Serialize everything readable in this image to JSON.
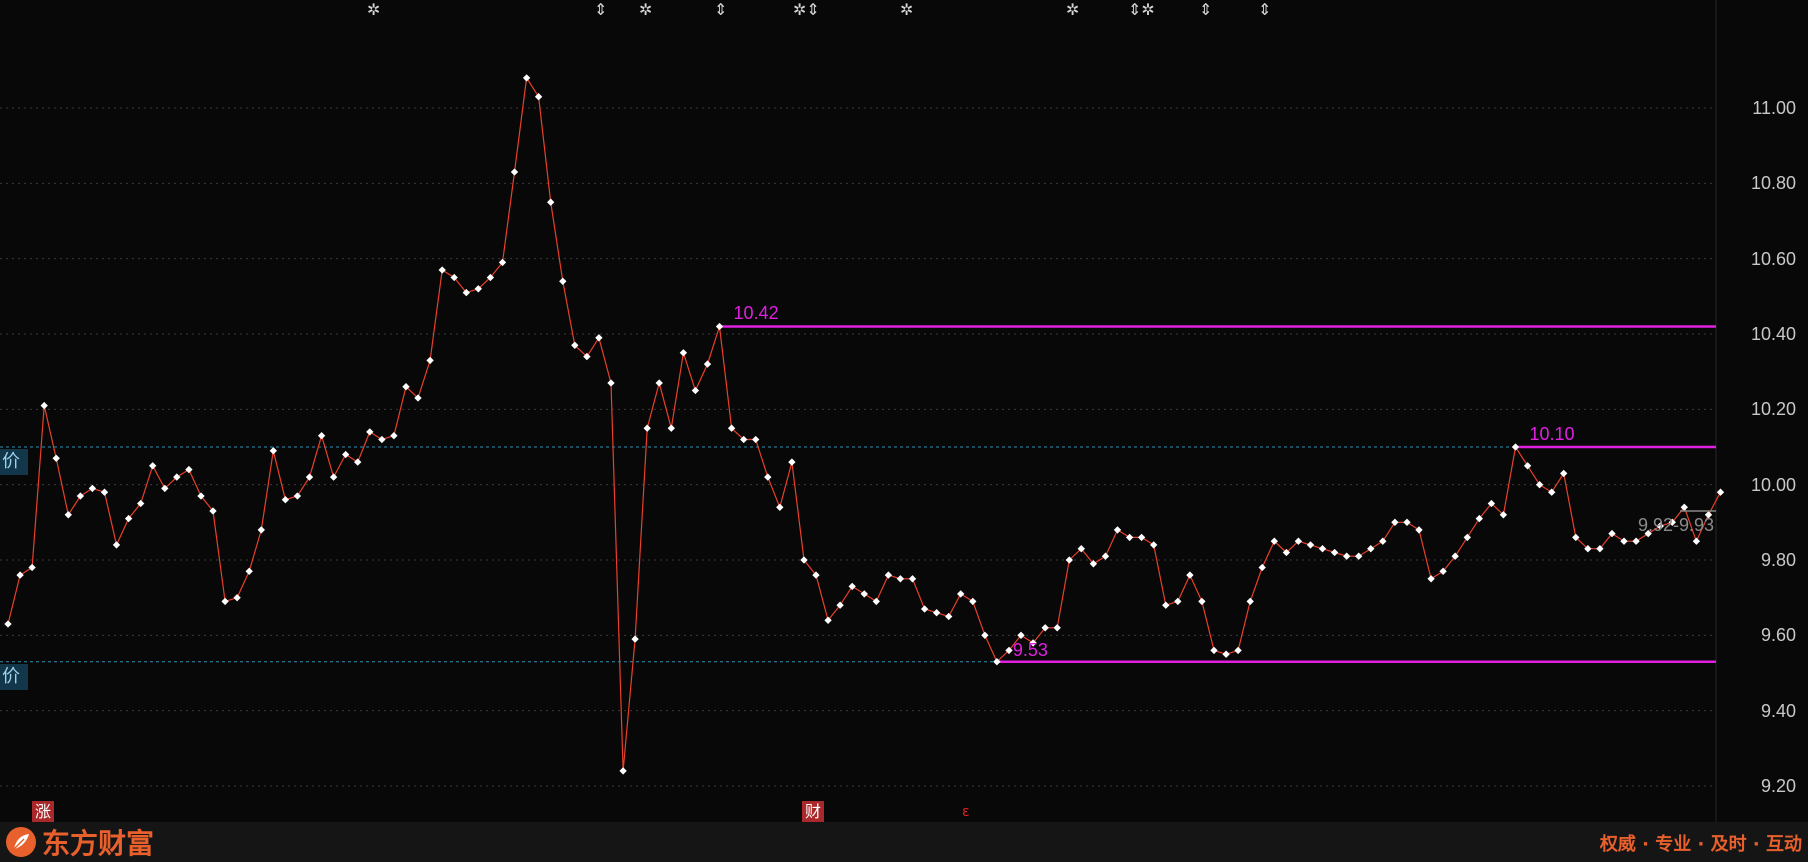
{
  "chart_data": {
    "type": "line",
    "y_ticks": [
      "11.00",
      "10.80",
      "10.60",
      "10.40",
      "10.20",
      "10.00",
      "9.80",
      "9.60",
      "9.40",
      "9.20"
    ],
    "ylim": [
      9.17,
      11.27
    ],
    "grid": true,
    "values": [
      9.63,
      9.76,
      9.78,
      10.21,
      10.07,
      9.92,
      9.97,
      9.99,
      9.98,
      9.84,
      9.91,
      9.95,
      10.05,
      9.99,
      10.02,
      10.04,
      9.97,
      9.93,
      9.69,
      9.7,
      9.77,
      9.88,
      10.09,
      9.96,
      9.97,
      10.02,
      10.13,
      10.02,
      10.08,
      10.06,
      10.14,
      10.12,
      10.13,
      10.26,
      10.23,
      10.33,
      10.57,
      10.55,
      10.51,
      10.52,
      10.55,
      10.59,
      10.83,
      11.08,
      11.03,
      10.75,
      10.54,
      10.37,
      10.34,
      10.39,
      10.27,
      9.24,
      9.59,
      10.15,
      10.27,
      10.15,
      10.35,
      10.25,
      10.32,
      10.42,
      10.15,
      10.12,
      10.12,
      10.02,
      9.94,
      10.06,
      9.8,
      9.76,
      9.64,
      9.68,
      9.73,
      9.71,
      9.69,
      9.76,
      9.75,
      9.75,
      9.67,
      9.66,
      9.65,
      9.71,
      9.69,
      9.6,
      9.53,
      9.56,
      9.6,
      9.58,
      9.62,
      9.62,
      9.8,
      9.83,
      9.79,
      9.81,
      9.88,
      9.86,
      9.86,
      9.84,
      9.68,
      9.69,
      9.76,
      9.69,
      9.56,
      9.55,
      9.56,
      9.69,
      9.78,
      9.85,
      9.82,
      9.85,
      9.84,
      9.83,
      9.82,
      9.81,
      9.81,
      9.83,
      9.85,
      9.9,
      9.9,
      9.88,
      9.75,
      9.77,
      9.81,
      9.86,
      9.91,
      9.95,
      9.92,
      10.1,
      10.05,
      10.0,
      9.98,
      10.03,
      9.86,
      9.83,
      9.83,
      9.87,
      9.85,
      9.85,
      9.87,
      9.89,
      9.9,
      9.94,
      9.85,
      9.92,
      9.98
    ],
    "ref_lines": [
      10.1,
      9.53
    ],
    "highlight_lines": [
      {
        "label": "10.42",
        "value": 10.42,
        "start_index": 59
      },
      {
        "label": "10.10",
        "value": 10.1,
        "start_index": 125
      },
      {
        "label": "9.53",
        "value": 9.53,
        "start_index": 82
      }
    ],
    "current_label": "9.92-9.93",
    "current_value": 9.93,
    "line_color": "#e8402a",
    "marker_color": "#ffffff",
    "highlight_color": "#e020e0",
    "ref_color": "#2c8fb6"
  },
  "side_tags": [
    "价",
    "价"
  ],
  "events": [
    "✲",
    "⇕",
    "✲",
    "⇕",
    "✲⇕",
    "✲",
    "✲",
    "⇕✲",
    "⇕",
    "⇕"
  ],
  "badges": [
    "涨",
    "财"
  ],
  "small_mark": "ε",
  "footer": {
    "logo_text": "东方财富",
    "slogan": "权威 · 专业 · 及时 · 互动",
    "logo_icon": "leaf-logo-icon",
    "brand_color": "#e8602c"
  }
}
